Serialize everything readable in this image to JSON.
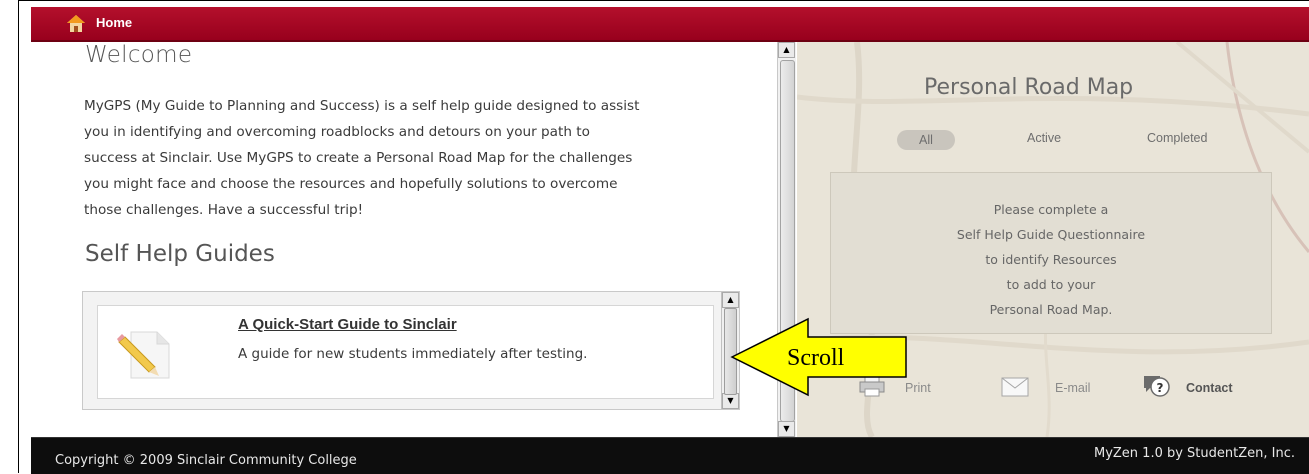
{
  "header": {
    "home_label": "Home"
  },
  "welcome": {
    "title": "Welcome",
    "lines": [
      "MyGPS (My Guide to Planning and Success) is a self help guide designed to assist",
      "you in identifying and overcoming roadblocks and detours on your path to",
      "success at Sinclair.  Use MyGPS to create a Personal Road Map for the challenges",
      "you might face and choose the resources and hopefully solutions to overcome",
      "those challenges.  Have a successful trip!"
    ]
  },
  "guides": {
    "title": "Self Help Guides",
    "items": [
      {
        "title": "A Quick-Start Guide to Sinclair",
        "description": "A guide for new students immediately after testing."
      }
    ]
  },
  "road_map": {
    "title": "Personal Road Map",
    "filters": [
      "All",
      "Active",
      "Completed"
    ],
    "message_lines": [
      "Please complete a",
      "Self Help Guide Questionnaire",
      "to identify Resources",
      "to add to your",
      "Personal Road Map."
    ],
    "actions": {
      "print": "Print",
      "email": "E-mail",
      "contact": "Contact"
    }
  },
  "callout": {
    "label": "Scroll",
    "color": "#ffff00"
  },
  "footer": {
    "copyright": "Copyright © 2009 Sinclair Community College",
    "credit": "MyZen 1.0 by StudentZen, Inc."
  },
  "colors": {
    "header": "#a8001f",
    "footer": "#0d0d0d",
    "map_bg": "#e9e4d8"
  }
}
